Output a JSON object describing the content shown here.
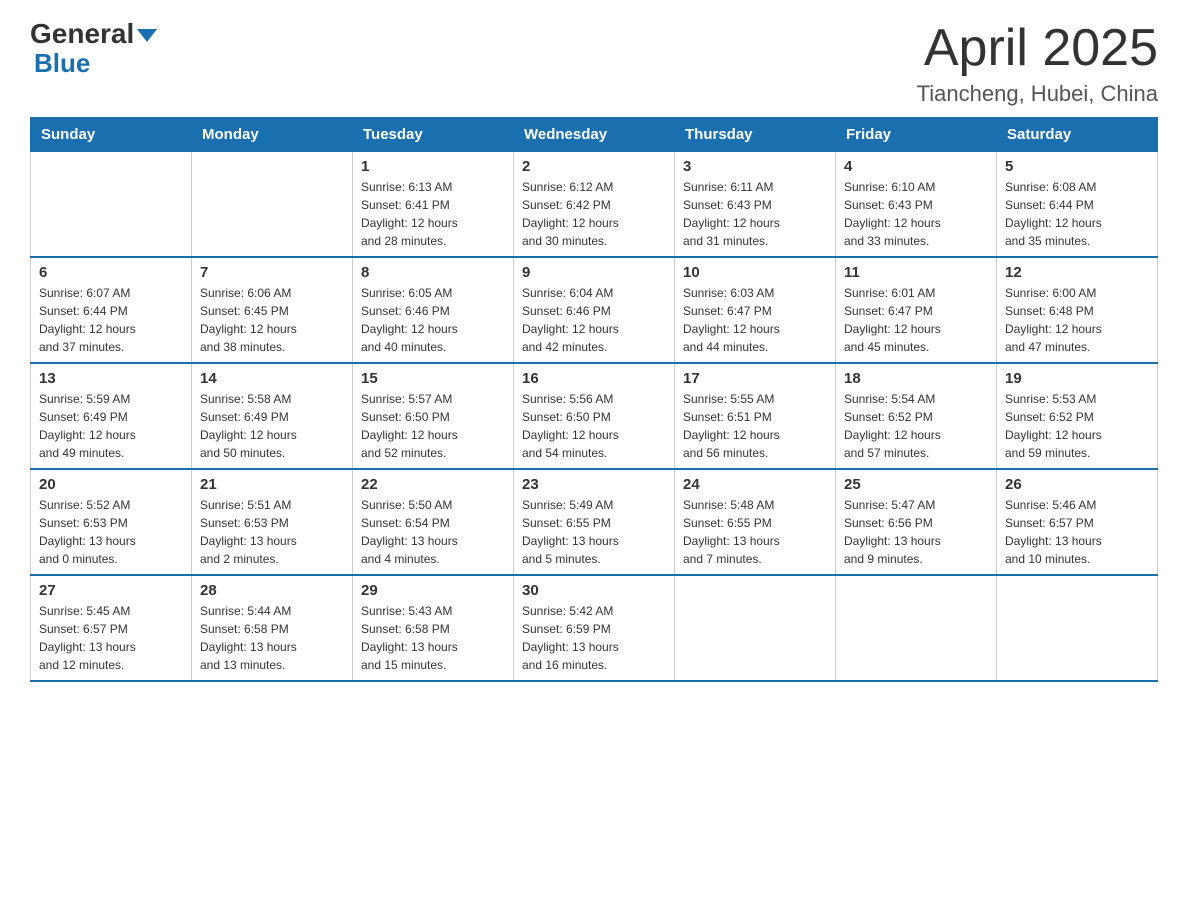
{
  "header": {
    "logo_line1_part1": "General",
    "logo_line1_part2": "Blue",
    "month_year": "April 2025",
    "location": "Tiancheng, Hubei, China"
  },
  "days_of_week": [
    "Sunday",
    "Monday",
    "Tuesday",
    "Wednesday",
    "Thursday",
    "Friday",
    "Saturday"
  ],
  "weeks": [
    [
      {
        "day": "",
        "info": ""
      },
      {
        "day": "",
        "info": ""
      },
      {
        "day": "1",
        "info": "Sunrise: 6:13 AM\nSunset: 6:41 PM\nDaylight: 12 hours\nand 28 minutes."
      },
      {
        "day": "2",
        "info": "Sunrise: 6:12 AM\nSunset: 6:42 PM\nDaylight: 12 hours\nand 30 minutes."
      },
      {
        "day": "3",
        "info": "Sunrise: 6:11 AM\nSunset: 6:43 PM\nDaylight: 12 hours\nand 31 minutes."
      },
      {
        "day": "4",
        "info": "Sunrise: 6:10 AM\nSunset: 6:43 PM\nDaylight: 12 hours\nand 33 minutes."
      },
      {
        "day": "5",
        "info": "Sunrise: 6:08 AM\nSunset: 6:44 PM\nDaylight: 12 hours\nand 35 minutes."
      }
    ],
    [
      {
        "day": "6",
        "info": "Sunrise: 6:07 AM\nSunset: 6:44 PM\nDaylight: 12 hours\nand 37 minutes."
      },
      {
        "day": "7",
        "info": "Sunrise: 6:06 AM\nSunset: 6:45 PM\nDaylight: 12 hours\nand 38 minutes."
      },
      {
        "day": "8",
        "info": "Sunrise: 6:05 AM\nSunset: 6:46 PM\nDaylight: 12 hours\nand 40 minutes."
      },
      {
        "day": "9",
        "info": "Sunrise: 6:04 AM\nSunset: 6:46 PM\nDaylight: 12 hours\nand 42 minutes."
      },
      {
        "day": "10",
        "info": "Sunrise: 6:03 AM\nSunset: 6:47 PM\nDaylight: 12 hours\nand 44 minutes."
      },
      {
        "day": "11",
        "info": "Sunrise: 6:01 AM\nSunset: 6:47 PM\nDaylight: 12 hours\nand 45 minutes."
      },
      {
        "day": "12",
        "info": "Sunrise: 6:00 AM\nSunset: 6:48 PM\nDaylight: 12 hours\nand 47 minutes."
      }
    ],
    [
      {
        "day": "13",
        "info": "Sunrise: 5:59 AM\nSunset: 6:49 PM\nDaylight: 12 hours\nand 49 minutes."
      },
      {
        "day": "14",
        "info": "Sunrise: 5:58 AM\nSunset: 6:49 PM\nDaylight: 12 hours\nand 50 minutes."
      },
      {
        "day": "15",
        "info": "Sunrise: 5:57 AM\nSunset: 6:50 PM\nDaylight: 12 hours\nand 52 minutes."
      },
      {
        "day": "16",
        "info": "Sunrise: 5:56 AM\nSunset: 6:50 PM\nDaylight: 12 hours\nand 54 minutes."
      },
      {
        "day": "17",
        "info": "Sunrise: 5:55 AM\nSunset: 6:51 PM\nDaylight: 12 hours\nand 56 minutes."
      },
      {
        "day": "18",
        "info": "Sunrise: 5:54 AM\nSunset: 6:52 PM\nDaylight: 12 hours\nand 57 minutes."
      },
      {
        "day": "19",
        "info": "Sunrise: 5:53 AM\nSunset: 6:52 PM\nDaylight: 12 hours\nand 59 minutes."
      }
    ],
    [
      {
        "day": "20",
        "info": "Sunrise: 5:52 AM\nSunset: 6:53 PM\nDaylight: 13 hours\nand 0 minutes."
      },
      {
        "day": "21",
        "info": "Sunrise: 5:51 AM\nSunset: 6:53 PM\nDaylight: 13 hours\nand 2 minutes."
      },
      {
        "day": "22",
        "info": "Sunrise: 5:50 AM\nSunset: 6:54 PM\nDaylight: 13 hours\nand 4 minutes."
      },
      {
        "day": "23",
        "info": "Sunrise: 5:49 AM\nSunset: 6:55 PM\nDaylight: 13 hours\nand 5 minutes."
      },
      {
        "day": "24",
        "info": "Sunrise: 5:48 AM\nSunset: 6:55 PM\nDaylight: 13 hours\nand 7 minutes."
      },
      {
        "day": "25",
        "info": "Sunrise: 5:47 AM\nSunset: 6:56 PM\nDaylight: 13 hours\nand 9 minutes."
      },
      {
        "day": "26",
        "info": "Sunrise: 5:46 AM\nSunset: 6:57 PM\nDaylight: 13 hours\nand 10 minutes."
      }
    ],
    [
      {
        "day": "27",
        "info": "Sunrise: 5:45 AM\nSunset: 6:57 PM\nDaylight: 13 hours\nand 12 minutes."
      },
      {
        "day": "28",
        "info": "Sunrise: 5:44 AM\nSunset: 6:58 PM\nDaylight: 13 hours\nand 13 minutes."
      },
      {
        "day": "29",
        "info": "Sunrise: 5:43 AM\nSunset: 6:58 PM\nDaylight: 13 hours\nand 15 minutes."
      },
      {
        "day": "30",
        "info": "Sunrise: 5:42 AM\nSunset: 6:59 PM\nDaylight: 13 hours\nand 16 minutes."
      },
      {
        "day": "",
        "info": ""
      },
      {
        "day": "",
        "info": ""
      },
      {
        "day": "",
        "info": ""
      }
    ]
  ]
}
